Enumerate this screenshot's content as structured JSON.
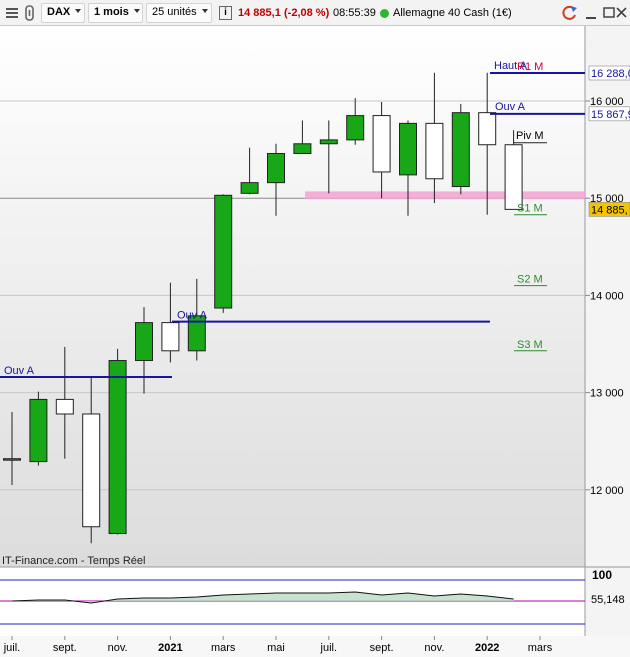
{
  "toolbar": {
    "instrument": "DAX",
    "period": "1 mois",
    "units": "25 unités",
    "info_icon": "i",
    "last_price": "14 885,1",
    "change": "(-2,08 %)",
    "time": "08:55:39",
    "market_name": "Allemagne 40 Cash (1€)",
    "colors": {
      "negative": "#c00000",
      "status_dot": "#2fb52f"
    }
  },
  "chart": {
    "watermark": "IT-Finance.com - Temps Réel",
    "x_tick_labels": [
      "juil.",
      "sept.",
      "nov.",
      "2021",
      "mars",
      "mai",
      "juil.",
      "sept.",
      "nov.",
      "2022",
      "mars"
    ],
    "y_tick_labels": [
      "16 000",
      "15 000",
      "14 000",
      "13 000",
      "12 000"
    ],
    "price_label": "14 885,",
    "level_labels": {
      "haut": "Haut A",
      "r1": "R1 M",
      "r1_value": "16 288,0",
      "ouv_a": "Ouv A",
      "ouv_a_value": "15 867,9",
      "piv": "Piv M",
      "s1": "S1 M",
      "s2": "S2 M",
      "s3": "S3 M",
      "ouv_a_2021": "Ouv A",
      "ouv_a_2020": "Ouv A"
    },
    "indicator": {
      "level": "100",
      "value": "55,148"
    },
    "colors": {
      "up": "#17a717",
      "down": "#ffffff",
      "level_line": "#1515a0",
      "pink_band": "#f2a2cf",
      "price_tag": "#f5c400",
      "support": "#2e8b2e",
      "r1": "#cc0044"
    }
  },
  "chart_data": {
    "type": "candlestick",
    "period": "monthly",
    "ylim": [
      11300,
      16700
    ],
    "y_ticks": [
      12000,
      13000,
      14000,
      15000,
      16000
    ],
    "last_price": 14885.1,
    "candles": [
      {
        "month": "2020-07",
        "open": 12320,
        "high": 12800,
        "low": 12050,
        "close": 12320
      },
      {
        "month": "2020-08",
        "open": 12290,
        "high": 13010,
        "low": 12250,
        "close": 12930
      },
      {
        "month": "2020-09",
        "open": 12930,
        "high": 13470,
        "low": 12320,
        "close": 12780
      },
      {
        "month": "2020-10",
        "open": 12780,
        "high": 13150,
        "low": 11450,
        "close": 11620
      },
      {
        "month": "2020-11",
        "open": 11550,
        "high": 13450,
        "low": 11540,
        "close": 13330
      },
      {
        "month": "2020-12",
        "open": 13330,
        "high": 13880,
        "low": 12990,
        "close": 13720
      },
      {
        "month": "2021-01",
        "open": 13720,
        "high": 14130,
        "low": 13310,
        "close": 13430
      },
      {
        "month": "2021-02",
        "open": 13430,
        "high": 14170,
        "low": 13330,
        "close": 13790
      },
      {
        "month": "2021-03",
        "open": 13870,
        "high": 15040,
        "low": 13820,
        "close": 15030
      },
      {
        "month": "2021-04",
        "open": 15050,
        "high": 15520,
        "low": 15040,
        "close": 15160
      },
      {
        "month": "2021-05",
        "open": 15160,
        "high": 15560,
        "low": 14820,
        "close": 15460
      },
      {
        "month": "2021-06",
        "open": 15460,
        "high": 15800,
        "low": 15460,
        "close": 15560
      },
      {
        "month": "2021-07",
        "open": 15560,
        "high": 15800,
        "low": 15050,
        "close": 15600
      },
      {
        "month": "2021-08",
        "open": 15600,
        "high": 16030,
        "low": 15550,
        "close": 15850
      },
      {
        "month": "2021-09",
        "open": 15850,
        "high": 15990,
        "low": 15000,
        "close": 15270
      },
      {
        "month": "2021-10",
        "open": 15240,
        "high": 15800,
        "low": 14820,
        "close": 15770
      },
      {
        "month": "2021-11",
        "open": 15770,
        "high": 16290,
        "low": 14950,
        "close": 15200
      },
      {
        "month": "2021-12",
        "open": 15120,
        "high": 15970,
        "low": 15040,
        "close": 15880
      },
      {
        "month": "2022-01",
        "open": 15880,
        "high": 16290,
        "low": 14830,
        "close": 15550
      },
      {
        "month": "2022-02",
        "open": 15550,
        "high": 15700,
        "low": 14890,
        "close": 14885
      }
    ],
    "levels": [
      {
        "name": "Haut A",
        "value": 16288
      },
      {
        "name": "R1 M",
        "value": 16288
      },
      {
        "name": "Ouv A",
        "value": 15868
      },
      {
        "name": "Piv M",
        "value": 15570
      },
      {
        "name": "S1 M",
        "value": 14830
      },
      {
        "name": "S2 M",
        "value": 14100
      },
      {
        "name": "S3 M",
        "value": 13430
      },
      {
        "name": "Ouv A (2021)",
        "value": 13730
      },
      {
        "name": "Ouv A (2020)",
        "value": 13160
      }
    ],
    "indicator": {
      "upper": 100,
      "last": 55.148
    }
  }
}
